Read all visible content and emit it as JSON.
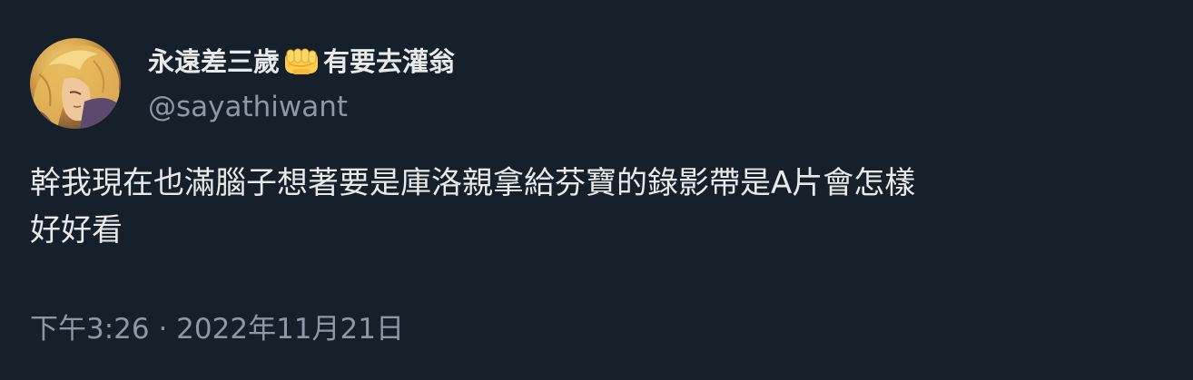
{
  "tweet": {
    "avatar_icon": "user-avatar-anime",
    "display_name_part1": "永遠差三歲",
    "display_name_emoji_icon": "oncoming-fist-icon",
    "display_name_part2": "有要去灌翁",
    "handle": "@sayathiwant",
    "text_line1": "幹我現在也滿腦子想著要是庫洛親拿給芬寶的錄影帶是A片會怎樣",
    "text_line2": "好好看",
    "timestamp": "下午3:26 · 2022年11月21日"
  },
  "colors": {
    "background": "#15202b",
    "primary_text": "#e7e9ea",
    "secondary_text": "#8b98a5"
  }
}
